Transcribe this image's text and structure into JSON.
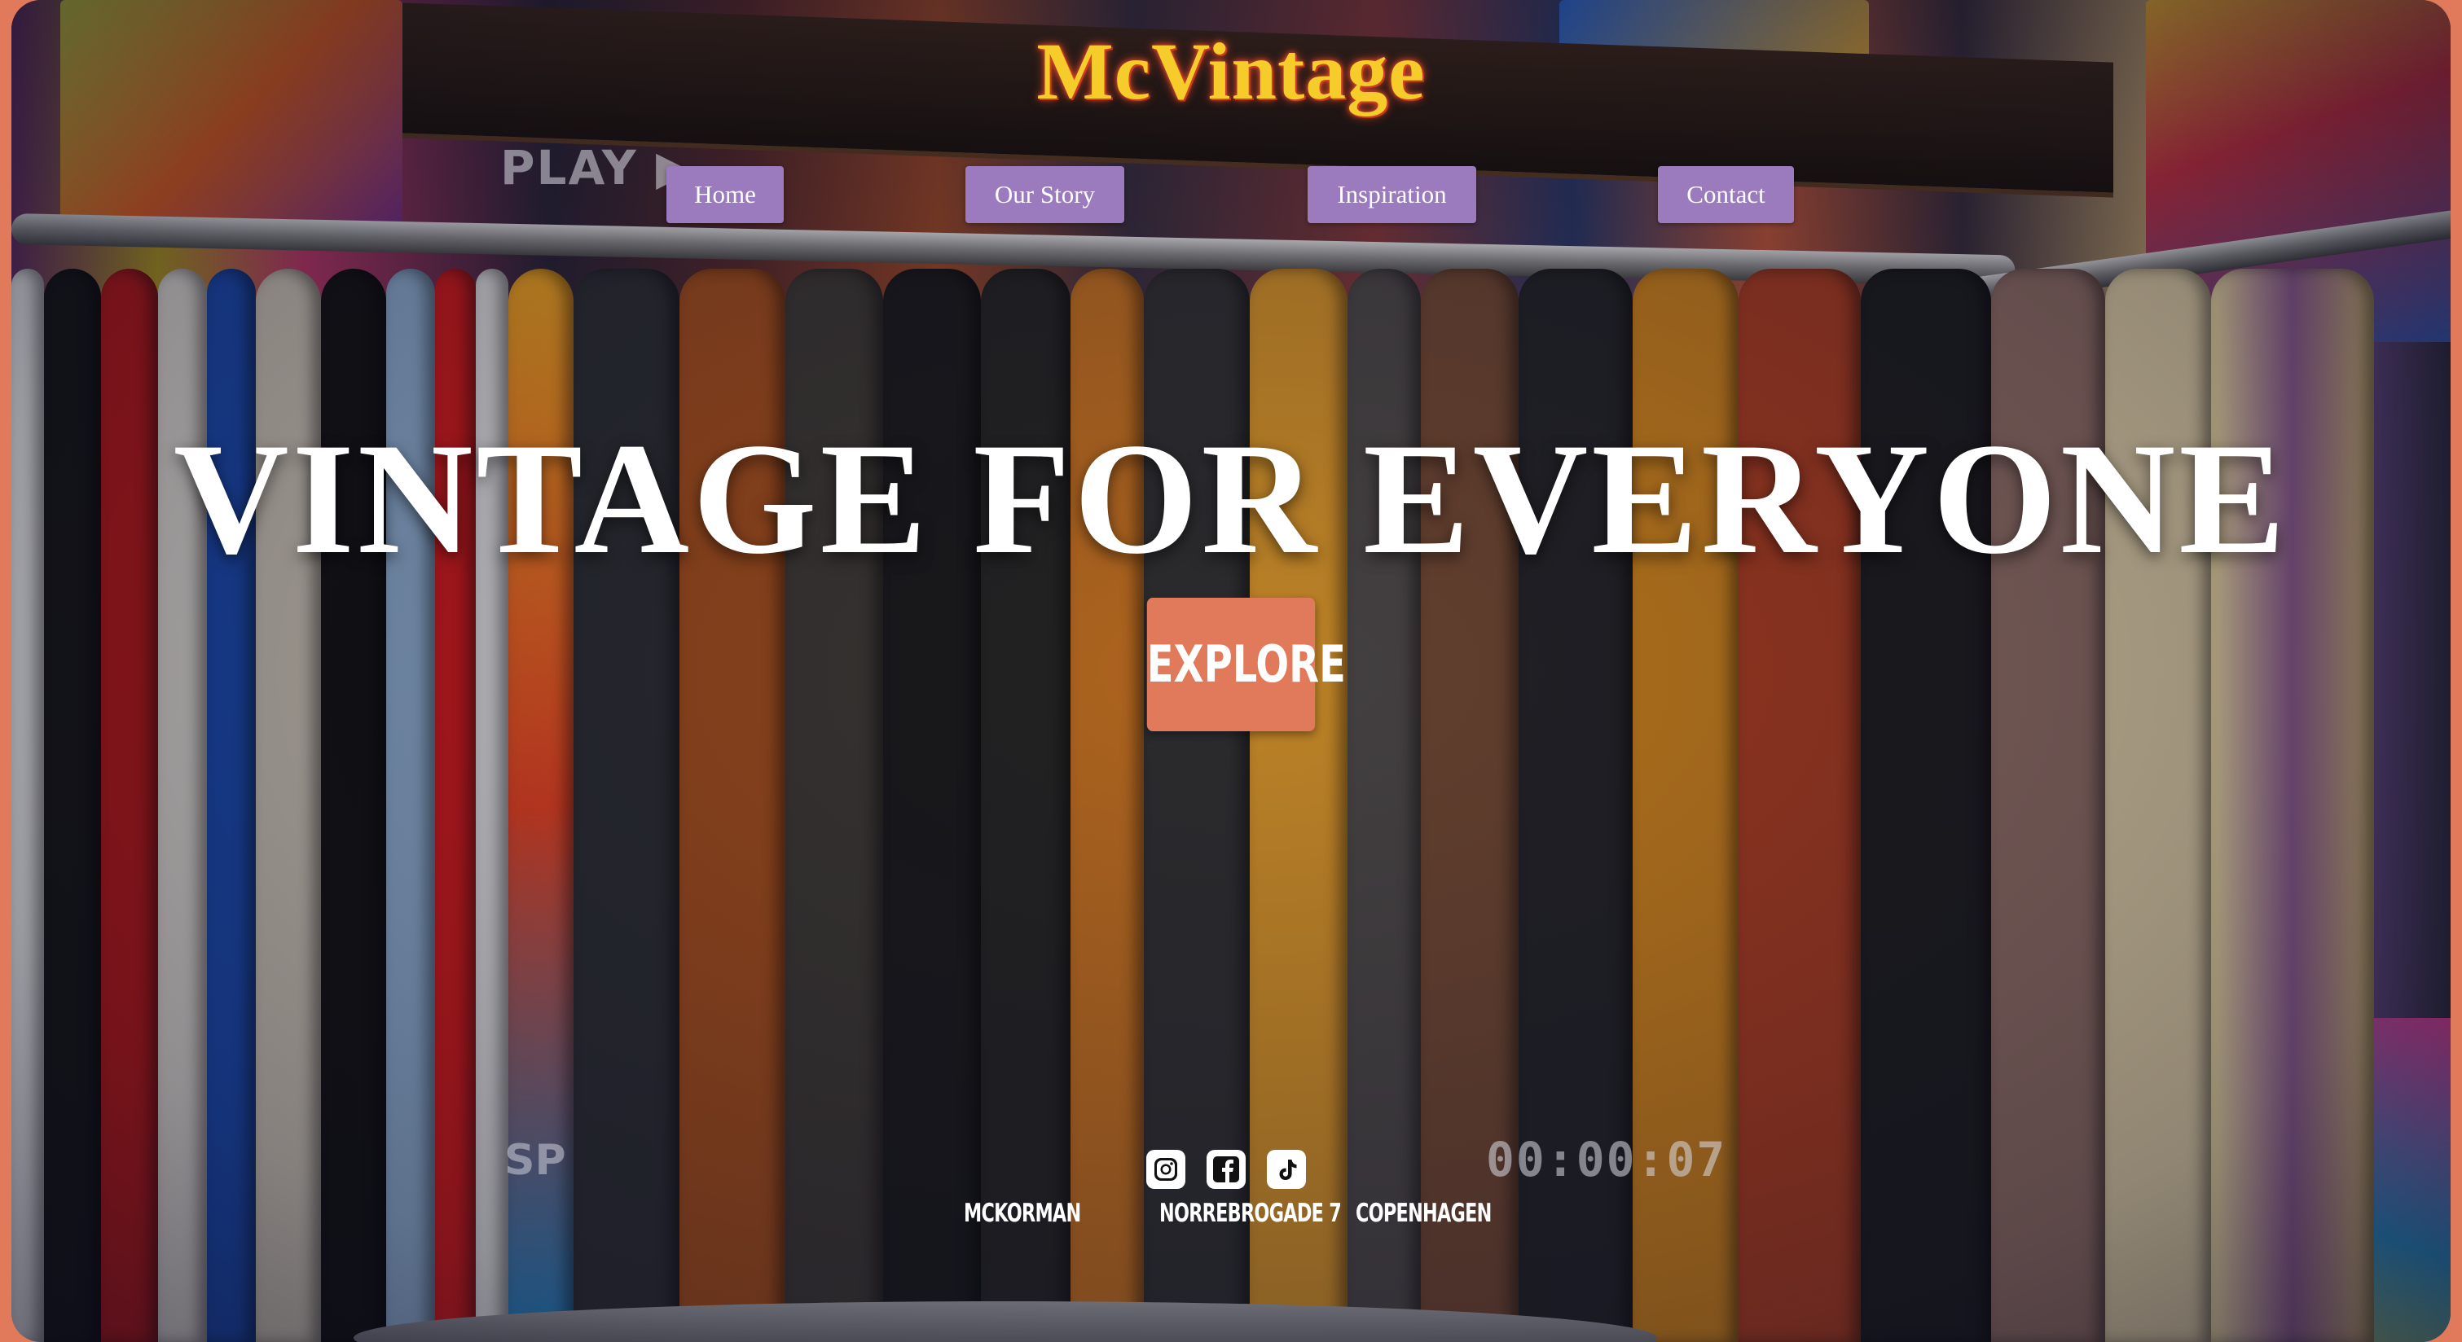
{
  "brand": {
    "name": "McVintage"
  },
  "nav": {
    "items": [
      {
        "label": "Home"
      },
      {
        "label": "Our Story"
      },
      {
        "label": "Inspiration"
      },
      {
        "label": "Contact"
      }
    ]
  },
  "hero": {
    "title": "VINTAGE FOR EVERYONE",
    "cta_label": "EXPLORE"
  },
  "background_overlay": {
    "play_text": "PLAY ▶",
    "sp_text": "SP",
    "timecode": "00:00:07"
  },
  "social": {
    "icons": [
      "instagram-icon",
      "facebook-icon",
      "tiktok-icon"
    ]
  },
  "footer": {
    "left": "MCKORMAN",
    "center": "NORREBROGADE 7",
    "right": "COPENHAGEN"
  },
  "colors": {
    "accent_orange": "#e07a5a",
    "nav_purple": "#9b7bbd",
    "logo_yellow": "#f5cc2a",
    "logo_glow": "#e0482a"
  }
}
